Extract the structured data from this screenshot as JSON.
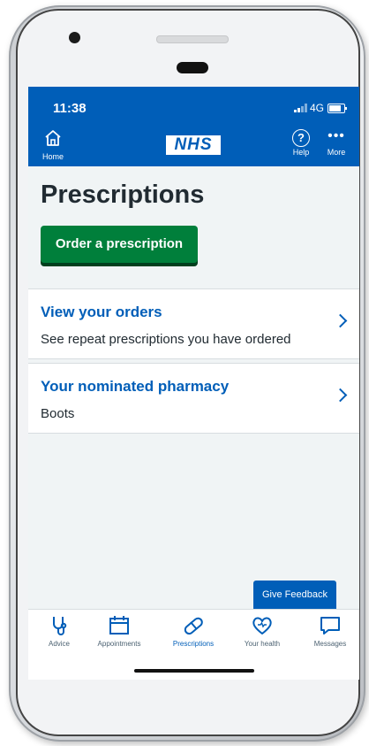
{
  "status_bar": {
    "time": "11:38",
    "network": "4G"
  },
  "header": {
    "home_label": "Home",
    "logo_text": "NHS",
    "help_label": "Help",
    "more_label": "More"
  },
  "main": {
    "title": "Prescriptions",
    "order_button": "Order a prescription",
    "cards": [
      {
        "title": "View your orders",
        "description": "See repeat prescriptions you have ordered"
      },
      {
        "title": "Your nominated pharmacy",
        "description": "Boots"
      }
    ]
  },
  "feedback_label": "Give Feedback",
  "tabs": [
    {
      "label": "Advice",
      "icon": "stethoscope-icon"
    },
    {
      "label": "Appointments",
      "icon": "calendar-icon"
    },
    {
      "label": "Prescriptions",
      "icon": "pill-icon",
      "active": true
    },
    {
      "label": "Your health",
      "icon": "heart-icon"
    },
    {
      "label": "Messages",
      "icon": "message-icon"
    }
  ],
  "colors": {
    "nhs_blue": "#005eb8",
    "button_green": "#007f3b",
    "background": "#f0f4f5",
    "text_dark": "#212b32"
  }
}
